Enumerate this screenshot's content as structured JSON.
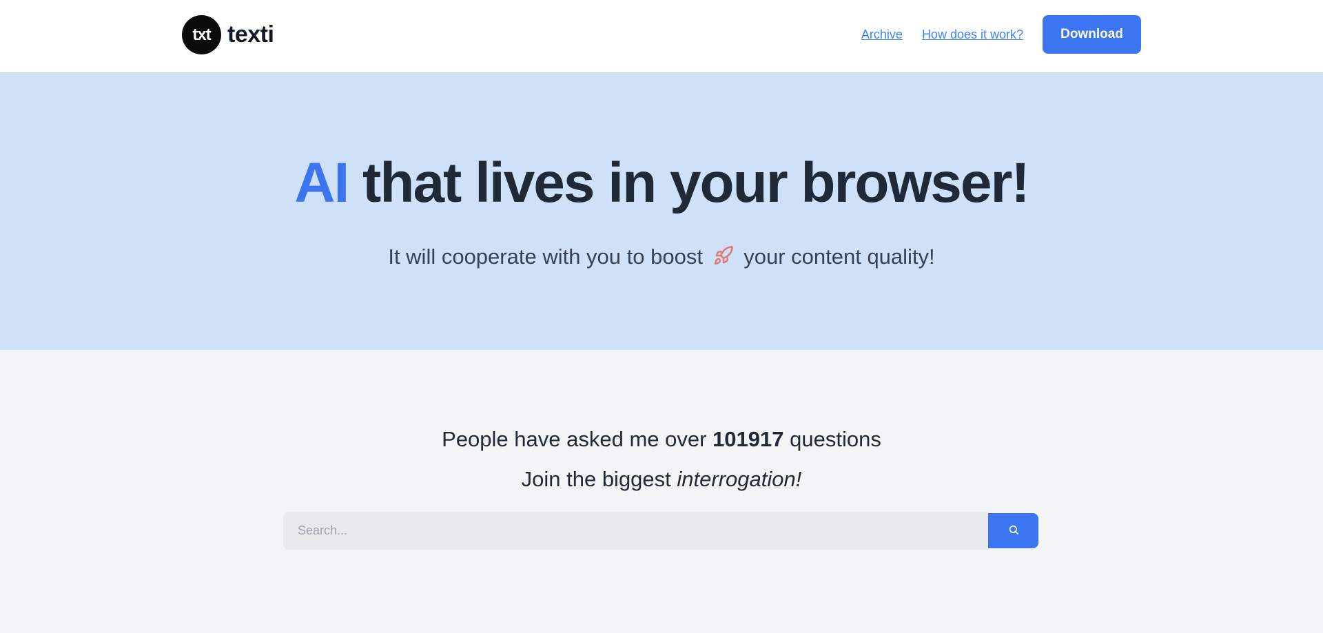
{
  "header": {
    "logo_text": "txt",
    "brand_name": "texti",
    "nav_links": [
      "Archive",
      "How does it work?"
    ],
    "download_label": "Download"
  },
  "hero": {
    "title_accent": "AI",
    "title_rest": "that lives in your browser!",
    "subtitle_before": "It will cooperate with you to boost",
    "subtitle_icon": "rocket-icon",
    "subtitle_after": "your content quality!"
  },
  "stats": {
    "prefix": "People have asked me over",
    "count": "101917",
    "suffix": "questions",
    "join_prefix": "Join the biggest",
    "join_emphasis": "interrogation!"
  },
  "search": {
    "placeholder": "Search...",
    "value": "",
    "button_icon": "search-icon"
  },
  "colors": {
    "accent": "#3b76f0",
    "hero_background": "#cfe0f9",
    "page_background": "#f3f4f6"
  }
}
